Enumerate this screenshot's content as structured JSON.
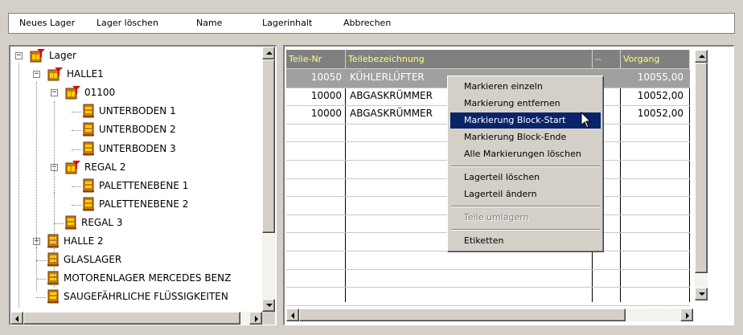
{
  "menubar": {
    "items": [
      "Neues Lager",
      "Lager löschen",
      "Name",
      "Lagerinhalt",
      "Abbrechen"
    ]
  },
  "tree": {
    "nodes": [
      {
        "label": "Lager",
        "icon": "warehouse-icon",
        "expander": "−"
      },
      {
        "label": "HALLE1",
        "icon": "warehouse-icon",
        "expander": "−"
      },
      {
        "label": "01100",
        "icon": "warehouse-icon",
        "expander": "−"
      },
      {
        "label": "UNTERBODEN 1",
        "icon": "shelf-icon"
      },
      {
        "label": "UNTERBODEN 2",
        "icon": "shelf-icon"
      },
      {
        "label": "UNTERBODEN 3",
        "icon": "shelf-icon"
      },
      {
        "label": "REGAL 2",
        "icon": "warehouse-icon",
        "expander": "−"
      },
      {
        "label": "PALETTENEBENE 1",
        "icon": "shelf-icon"
      },
      {
        "label": "PALETTENEBENE 2",
        "icon": "shelf-icon"
      },
      {
        "label": "REGAL 3",
        "icon": "shelf-icon"
      },
      {
        "label": "HALLE 2",
        "icon": "shelf-icon",
        "expander": "+"
      },
      {
        "label": "GLASLAGER",
        "icon": "shelf-icon"
      },
      {
        "label": "MOTORENLAGER MERCEDES BENZ",
        "icon": "shelf-icon"
      },
      {
        "label": "SAUGEFÄHRLICHE FLÜSSIGKEITEN",
        "icon": "shelf-icon"
      }
    ]
  },
  "grid": {
    "columns": [
      "Teile-Nr",
      "Teilebezeichnung",
      "--",
      "Vorgang"
    ],
    "rows": [
      {
        "teilenr": "10050",
        "bezeichnung": "KÜHLERLÜFTER",
        "extra": "",
        "vorgang": "10055,00",
        "selected": true
      },
      {
        "teilenr": "10000",
        "bezeichnung": "ABGASKRÜMMER",
        "extra": "",
        "vorgang": "10052,00",
        "selected": false
      },
      {
        "teilenr": "10000",
        "bezeichnung": "ABGASKRÜMMER",
        "extra": "",
        "vorgang": "10052,00",
        "selected": false
      }
    ]
  },
  "context_menu": {
    "items": [
      {
        "label": "Markieren einzeln"
      },
      {
        "label": "Markierung entfernen"
      },
      {
        "label": "Markierung Block-Start",
        "selected": true
      },
      {
        "label": "Markierung Block-Ende"
      },
      {
        "label": "Alle Markierungen löschen"
      },
      {
        "separator": true
      },
      {
        "label": "Lagerteil löschen"
      },
      {
        "label": "Lagerteil ändern"
      },
      {
        "separator": true
      },
      {
        "label": "Teile umlagern",
        "disabled": true
      },
      {
        "separator": true
      },
      {
        "label": "Etiketten"
      }
    ]
  },
  "colors": {
    "window_bg": "#d4d0c8",
    "header_bg": "#808080",
    "header_text": "#ffff80",
    "selection": "#0a246a",
    "selected_row": "#a0a0a0"
  }
}
